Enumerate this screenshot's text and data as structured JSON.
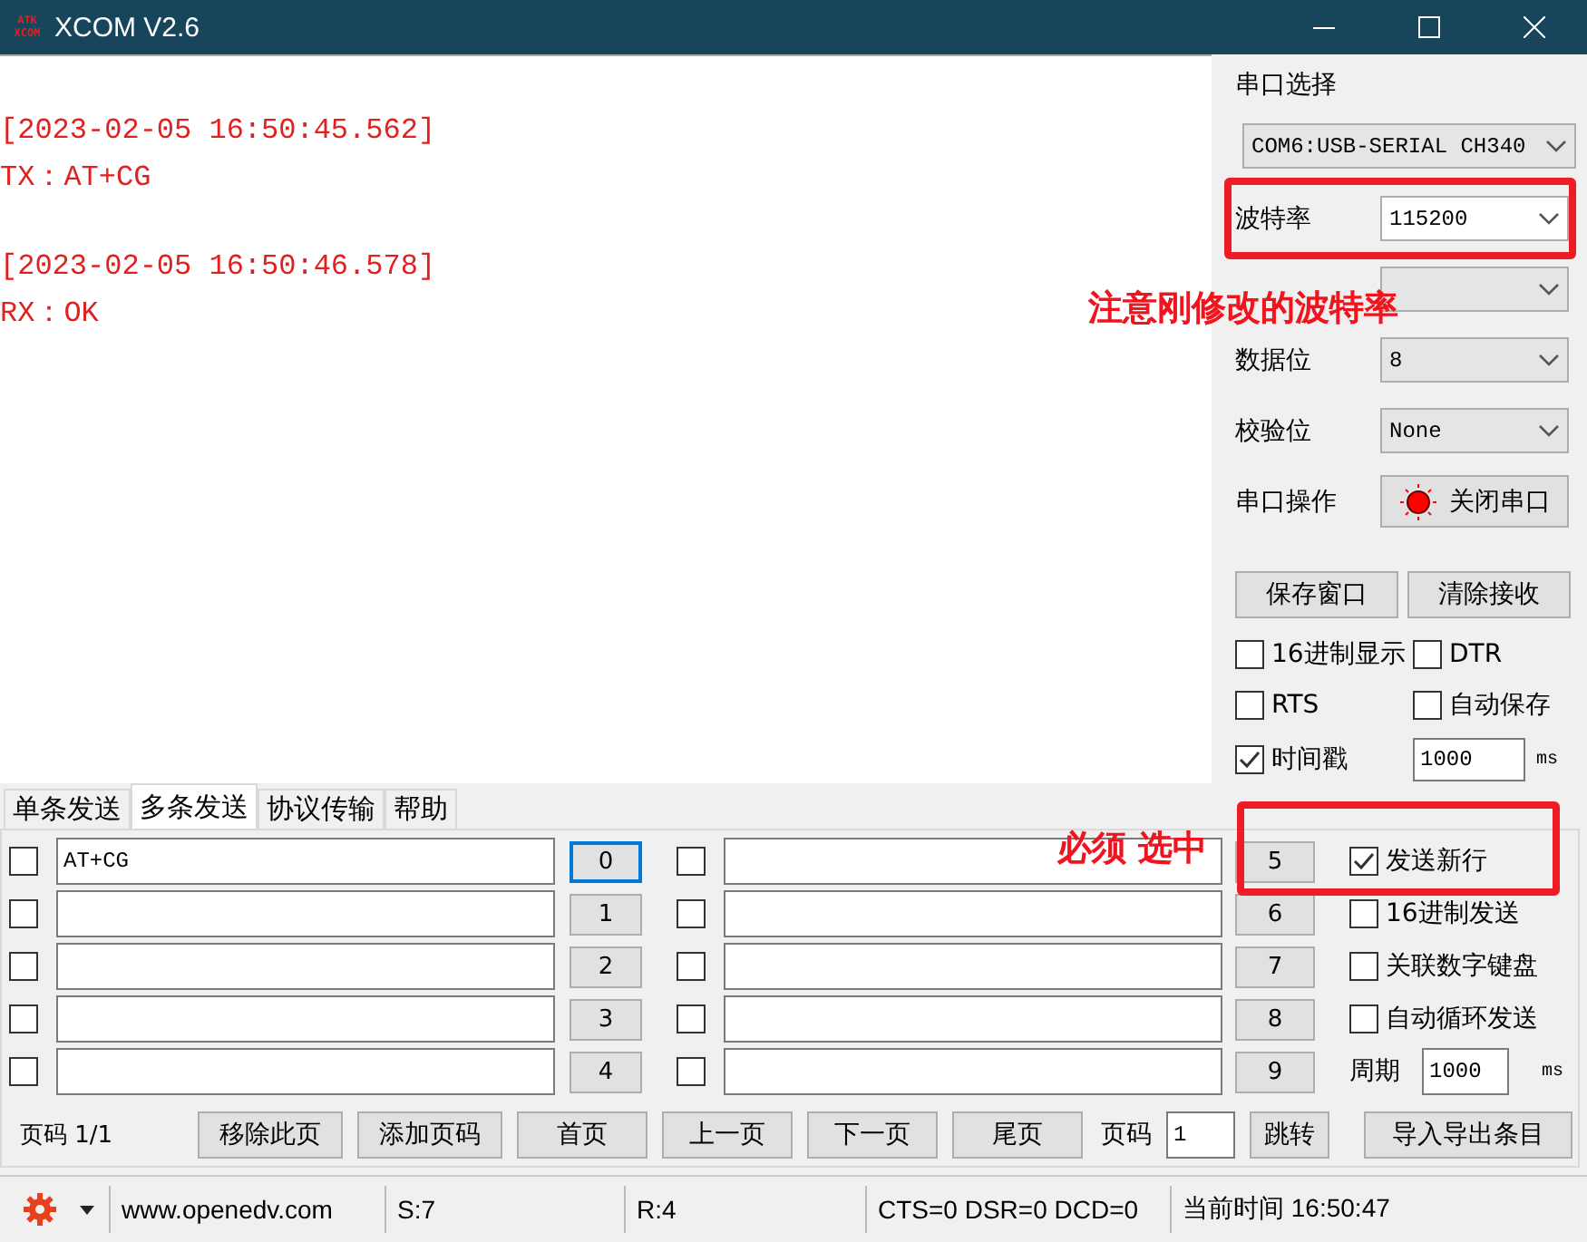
{
  "window": {
    "logo_lines": [
      "ATK",
      "XCOM"
    ],
    "title": "XCOM V2.6"
  },
  "receive": {
    "entries": [
      {
        "timestamp": "[2023-02-05 16:50:45.562]",
        "text": "TX：AT+CG"
      },
      {
        "timestamp": "[2023-02-05 16:50:46.578]",
        "text": "RX：OK"
      }
    ]
  },
  "serial_panel": {
    "port_label": "串口选择",
    "port_value": "COM6:USB-SERIAL CH340",
    "settings": [
      {
        "label": "波特率",
        "value": "115200",
        "editable": true
      },
      {
        "editable": false
      },
      {
        "label": "数据位",
        "value": "8",
        "editable": false
      },
      {
        "label": "校验位",
        "value": "None",
        "editable": false
      }
    ],
    "operation_label": "串口操作",
    "operation_button": "关闭串口",
    "port_open": true,
    "buttons": [
      "保存窗口",
      "清除接收"
    ],
    "options": [
      {
        "label": "16进制显示",
        "checked": false
      },
      {
        "label": "DTR",
        "checked": false
      },
      {
        "label": "RTS",
        "checked": false
      },
      {
        "label": "自动保存",
        "checked": false
      },
      {
        "label": "时间戳",
        "checked": true
      }
    ],
    "timestamp_interval": "1000",
    "interval_unit": "ms"
  },
  "tabs": [
    {
      "label": "单条发送",
      "selected": false
    },
    {
      "label": "多条发送",
      "selected": true
    },
    {
      "label": "协议传输",
      "selected": false
    },
    {
      "label": "帮助",
      "selected": false
    }
  ],
  "multi_send": {
    "items": [
      {
        "checked": false,
        "value": "AT+CG",
        "button": "0",
        "focused": true
      },
      {
        "checked": false,
        "button": "1",
        "focused": false
      },
      {
        "checked": false,
        "button": "2",
        "focused": false
      },
      {
        "checked": false,
        "button": "3",
        "focused": false
      },
      {
        "checked": false,
        "button": "4",
        "focused": false
      },
      {
        "checked": false,
        "button": "5",
        "focused": false
      },
      {
        "checked": false,
        "button": "6",
        "focused": false
      },
      {
        "checked": false,
        "button": "7",
        "focused": false
      },
      {
        "checked": false,
        "button": "8",
        "focused": false
      },
      {
        "checked": false,
        "button": "9",
        "focused": false
      }
    ],
    "options": [
      {
        "kind": "checkbox",
        "label": "发送新行",
        "checked": true
      },
      {
        "kind": "checkbox",
        "label": "16进制发送",
        "checked": false
      },
      {
        "kind": "checkbox",
        "label": "关联数字键盘",
        "checked": false
      },
      {
        "kind": "checkbox",
        "label": "自动循环发送",
        "checked": false
      },
      {
        "kind": "period",
        "label": "周期",
        "value": "1000",
        "unit": "ms"
      }
    ],
    "page_info": "页码 1/1",
    "page_buttons": [
      "移除此页",
      "添加页码",
      "首页",
      "上一页",
      "下一页",
      "尾页"
    ],
    "page_label": "页码",
    "page_value": "1",
    "jump_button": "跳转",
    "import_button": "导入导出条目"
  },
  "annotations": [
    {
      "text": "注意刚修改的波特率"
    },
    {
      "text": "必须 选中"
    }
  ],
  "status_bar": {
    "website": "www.openedv.com",
    "sent": "S:7",
    "received": "R:4",
    "signals": "CTS=0 DSR=0 DCD=0",
    "time": "当前时间 16:50:47"
  }
}
